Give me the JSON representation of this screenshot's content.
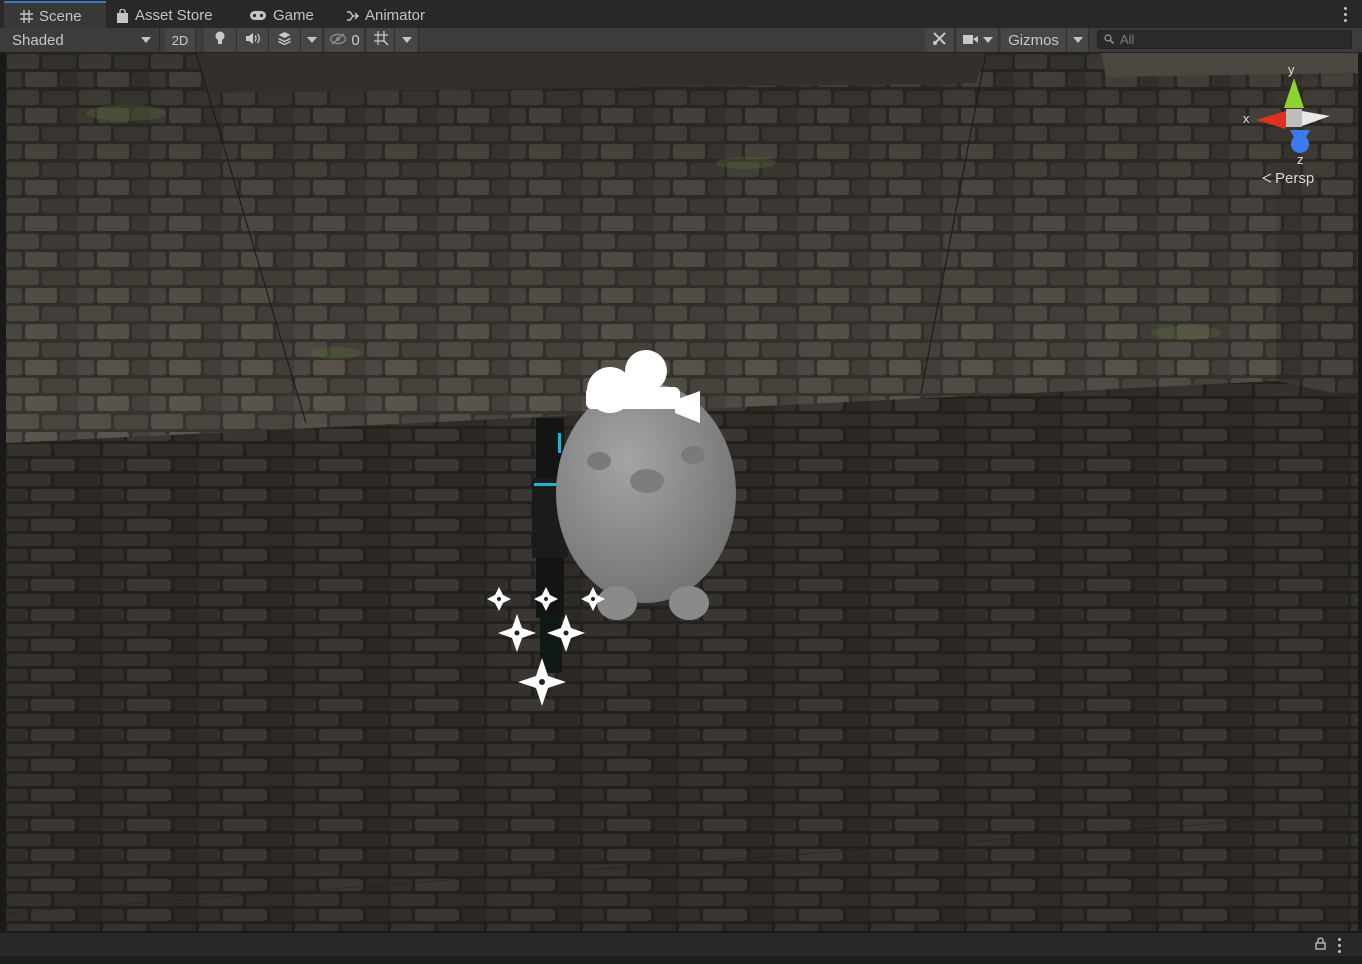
{
  "tabs": [
    {
      "label": "Scene",
      "icon": "grid-icon",
      "active": true
    },
    {
      "label": "Asset Store",
      "icon": "shopping-bag-icon",
      "active": false
    },
    {
      "label": "Game",
      "icon": "gamepad-icon",
      "active": false
    },
    {
      "label": "Animator",
      "icon": "animator-icon",
      "active": false
    }
  ],
  "toolbar": {
    "draw_mode": "Shaded",
    "mode_2d": "2D",
    "lighting_icon": "lightbulb-icon",
    "audio_icon": "speaker-icon",
    "effects_icon": "effects-layers-icon",
    "hidden_count": "0",
    "hidden_icon": "eye-slash-icon",
    "grid_icon": "grid-snap-icon",
    "tools_icon": "tools-icon",
    "camera_icon": "camera-icon",
    "gizmos_label": "Gizmos",
    "search_placeholder": "All"
  },
  "scene_gizmo": {
    "axis_y": "y",
    "axis_x": "x",
    "axis_z": "z",
    "projection": "Persp"
  },
  "colors": {
    "tab_active_accent": "#3a79bb",
    "axis_x": "#e0301e",
    "axis_y": "#8ed22f",
    "axis_z": "#3a7cf0"
  }
}
